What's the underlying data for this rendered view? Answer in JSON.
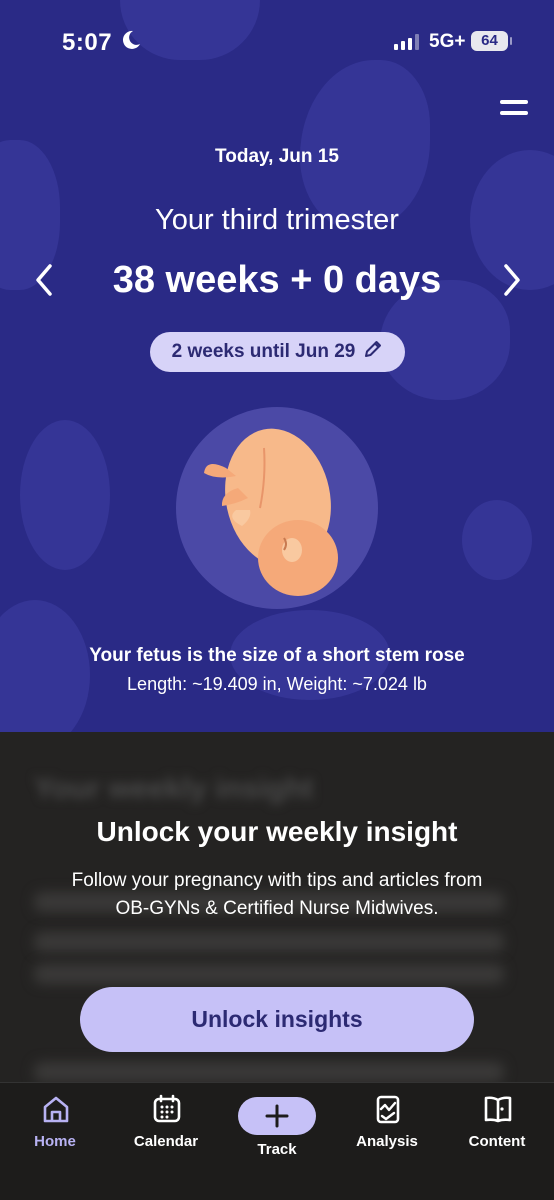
{
  "status_bar": {
    "time": "5:07",
    "network": "5G+",
    "battery": "64",
    "icons": [
      "moon-icon",
      "signal-icon",
      "battery-icon"
    ]
  },
  "header": {
    "menu_icon": "hamburger-icon",
    "date": "Today, Jun 15",
    "trimester": "Your third trimester",
    "weeks": "38 weeks + 0 days",
    "prev_icon": "chevron-left-icon",
    "next_icon": "chevron-right-icon",
    "until": "2 weeks until Jun 29",
    "edit_icon": "pencil-icon"
  },
  "fetus": {
    "size_title": "Your fetus is the size of a short stem rose",
    "size_meta": "Length: ~19.409 in, Weight: ~7.024 lb"
  },
  "insight": {
    "blurred_title": "Your weekly insight",
    "unlock_title": "Unlock your weekly insight",
    "unlock_desc": "Follow your pregnancy with tips and articles from OB-GYNs & Certified Nurse Midwives.",
    "unlock_button": "Unlock insights"
  },
  "tabs": [
    {
      "label": "Home",
      "icon": "home-icon",
      "active": true
    },
    {
      "label": "Calendar",
      "icon": "calendar-icon",
      "active": false
    },
    {
      "label": "Track",
      "icon": "plus-icon",
      "active": false
    },
    {
      "label": "Analysis",
      "icon": "analysis-icon",
      "active": false
    },
    {
      "label": "Content",
      "icon": "book-icon",
      "active": false
    }
  ],
  "colors": {
    "hero_bg": "#2a2a86",
    "accent": "#c6c1f7",
    "active_tab": "#b8b2f3",
    "sheet_bg": "#242322"
  }
}
